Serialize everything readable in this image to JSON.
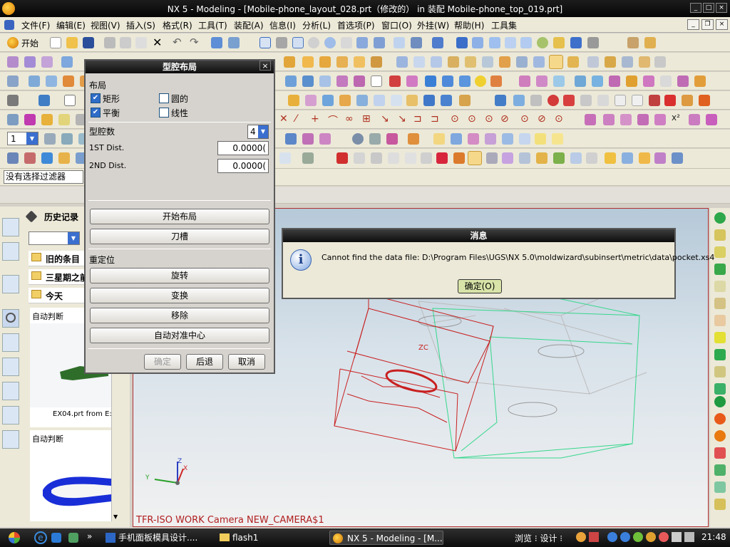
{
  "window": {
    "title": "NX 5 - Modeling - [Mobile-phone_layout_028.prt（修改的） in 装配 Mobile-phone_top_019.prt]"
  },
  "menubar": {
    "items": [
      "文件(F)",
      "编辑(E)",
      "视图(V)",
      "插入(S)",
      "格式(R)",
      "工具(T)",
      "装配(A)",
      "信息(I)",
      "分析(L)",
      "首选项(P)",
      "窗口(O)",
      "外挂(W)",
      "帮助(H)",
      "工具集"
    ]
  },
  "toolbar": {
    "start_label": "开始",
    "layer_value": "1",
    "filter_value": "没有选择过滤器"
  },
  "nav": {
    "title": "历史记录",
    "groups": [
      "旧的条目",
      "三星期之前",
      "今天"
    ],
    "items": [
      {
        "label": "自动判断",
        "file": "EX04.prt from E:"
      },
      {
        "label": "自动判断"
      }
    ]
  },
  "cavity_dialog": {
    "title": "型腔布局",
    "layout_section": "布局",
    "opt_rect": "矩形",
    "opt_round": "圆的",
    "opt_balance": "平衡",
    "opt_linear": "线性",
    "rect_checked": true,
    "balance_checked": true,
    "count_label": "型腔数",
    "count_value": "4",
    "dist1_label": "1ST Dist.",
    "dist1_value": "0.0000(",
    "dist2_label": "2ND Dist.",
    "dist2_value": "0.0000(",
    "start_layout": "开始布局",
    "insert_pocket": "刀槽",
    "reposition": "重定位",
    "rotate": "旋转",
    "transform": "变换",
    "remove": "移除",
    "auto_center": "自动对准中心",
    "ok": "确定",
    "back": "后退",
    "cancel": "取消"
  },
  "message_dialog": {
    "title": "消息",
    "text": "Cannot find the data file: D:\\Program Files\\UGS\\NX 5.0\\moldwizard\\subinsert\\metric\\data\\pocket.xs4",
    "ok": "确定(O)"
  },
  "graphics": {
    "camera_label": "TFR-ISO WORK Camera NEW_CAMERA$1",
    "zc_label": "ZC",
    "axis_z": "Z",
    "axis_x": "X",
    "axis_y": "Y"
  },
  "taskbar": {
    "tasks": [
      "手机面板模具设计....",
      "flash1",
      "NX 5 - Modeling - [M..."
    ],
    "tray_text": "浏览 ⁝ 设计 ⁝",
    "time": "21:48"
  },
  "colors": {
    "dialog_caption": "#1a1a1a",
    "red_wire": "#c82020",
    "green_wire": "#30d890"
  }
}
